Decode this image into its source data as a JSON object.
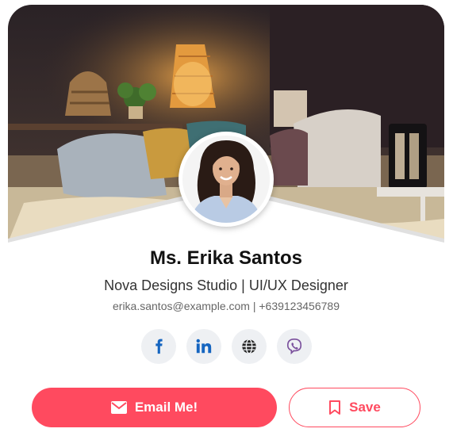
{
  "profile": {
    "name": "Ms. Erika Santos",
    "subtitle": "Nova Designs Studio | UI/UX Designer",
    "contact": "erika.santos@example.com | +639123456789"
  },
  "socials": [
    {
      "icon": "facebook-icon"
    },
    {
      "icon": "linkedin-icon"
    },
    {
      "icon": "globe-icon"
    },
    {
      "icon": "viber-icon"
    }
  ],
  "actions": {
    "email_label": "Email Me!",
    "save_label": "Save"
  },
  "colors": {
    "accent": "#ff4a5f",
    "social_bg": "#eef0f3",
    "social_icon": "#1565c0",
    "viber": "#7b519d"
  }
}
